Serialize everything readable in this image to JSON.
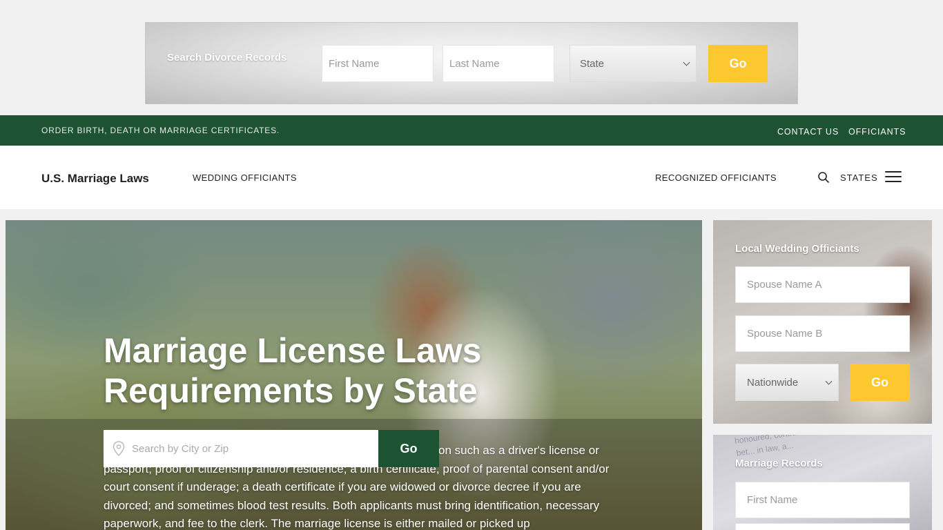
{
  "divorce_search": {
    "label": "Search Divorce Records",
    "first_name_placeholder": "First Name",
    "last_name_placeholder": "Last Name",
    "state_selected": "State",
    "go_label": "Go"
  },
  "top_bar": {
    "promo": "ORDER BIRTH, DEATH OR MARRIAGE CERTIFICATES.",
    "links": [
      "CONTACT US",
      "OFFICIANTS"
    ]
  },
  "nav": {
    "brand": "U.S. Marriage Laws",
    "wedding_officiants": "WEDDING OFFICIANTS",
    "recognized_officiants": "RECOGNIZED OFFICIANTS",
    "states": "STATES"
  },
  "hero": {
    "title_line1": "Marriage License Laws",
    "title_line2": "Requirements by State",
    "search_placeholder": "Search by City or Zip",
    "go_label": "Go",
    "paragraph": "on such as a driver's license or passport; proof of citizenship and/or residence; a birth certificate, proof of parental consent and/or court consent if underage; a death certificate if you are widowed or divorce decree if you are divorced; and sometimes blood test results. Both applicants must bring identification, necessary paperwork, and fee to the clerk. The marriage license is either mailed or picked up"
  },
  "officiants_card": {
    "title": "Local Wedding Officiants",
    "spouse_a_placeholder": "Spouse Name A",
    "spouse_b_placeholder": "Spouse Name B",
    "location_selected": "Nationwide",
    "go_label": "Go"
  },
  "records_card": {
    "title": "Marriage Records",
    "first_name_placeholder": "First Name",
    "background_text": "honoured, contract is required to ... is an agreement bet... in law, a..."
  },
  "colors": {
    "green": "#1d5233",
    "yellow": "#fcc72f"
  }
}
